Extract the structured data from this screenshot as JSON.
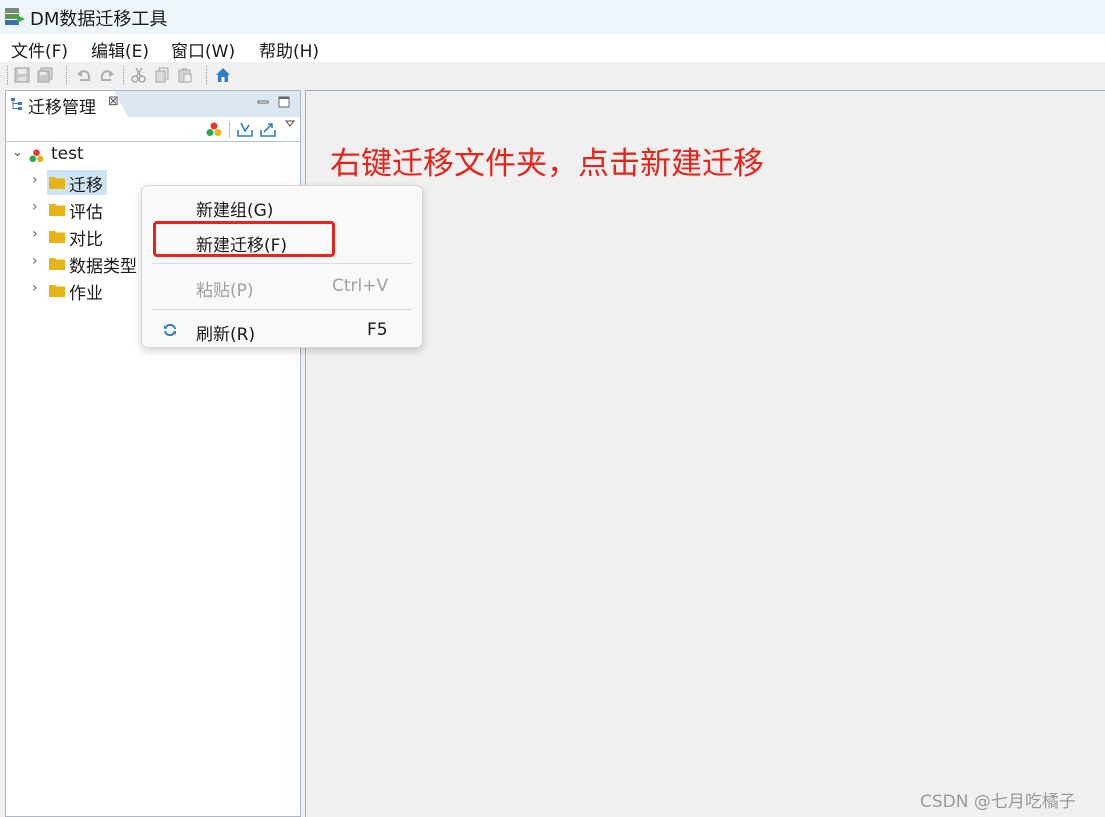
{
  "window": {
    "title": "DM数据迁移工具"
  },
  "menubar": {
    "items": [
      {
        "label": "文件(F)"
      },
      {
        "label": "编辑(E)"
      },
      {
        "label": "窗口(W)"
      },
      {
        "label": "帮助(H)"
      }
    ]
  },
  "toolbar": {
    "icons": [
      "save-icon",
      "save-all-icon",
      "undo-icon",
      "redo-icon",
      "cut-icon",
      "copy-icon",
      "paste-icon",
      "home-icon"
    ]
  },
  "left_view": {
    "tab_label": "迁移管理",
    "tree": {
      "root": "test",
      "children": [
        "迁移",
        "评估",
        "对比",
        "数据类型",
        "作业"
      ],
      "selected": "迁移"
    }
  },
  "context_menu": {
    "items": [
      {
        "label": "新建组(G)",
        "shortcut": ""
      },
      {
        "label": "新建迁移(F)",
        "shortcut": ""
      },
      {
        "label": "粘贴(P)",
        "shortcut": "Ctrl+V",
        "disabled": true
      },
      {
        "label": "刷新(R)",
        "shortcut": "F5"
      }
    ]
  },
  "annotation": {
    "text": "右键迁移文件夹，点击新建迁移",
    "color": "#e8231a"
  },
  "watermark": {
    "text": "CSDN @七月吃橘子"
  },
  "colors": {
    "accent": "#e8231a",
    "folder": "#e6b318",
    "link_blue": "#2f7fc8"
  }
}
